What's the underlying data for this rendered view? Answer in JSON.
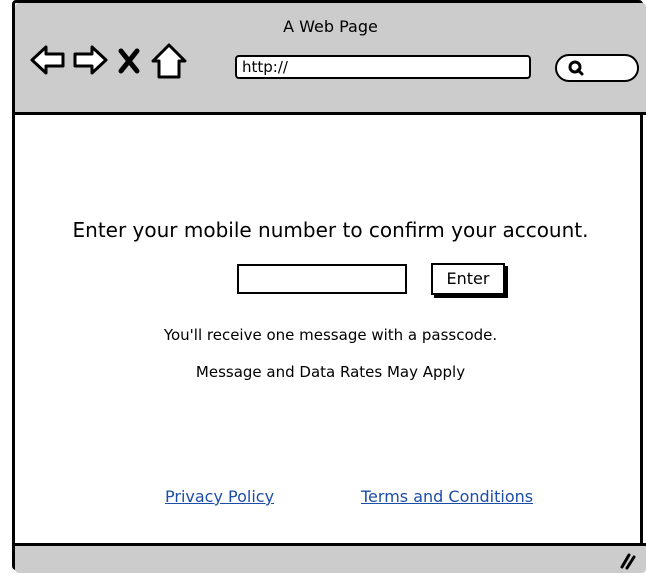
{
  "window": {
    "title": "A Web Page",
    "url": "http://"
  },
  "icons": {
    "back": "left-arrow-icon",
    "forward": "right-arrow-icon",
    "stop": "close-icon",
    "home": "home-icon",
    "search": "search-icon",
    "resize": "resize-grip-icon"
  },
  "main": {
    "prompt": "Enter your mobile number to confirm your account.",
    "phone_value": "",
    "enter_label": "Enter",
    "info_line1": "You'll receive one message with a passcode.",
    "info_line2": "Message and Data Rates May Apply"
  },
  "footer": {
    "privacy_label": "Privacy Policy",
    "terms_label": "Terms and Conditions"
  },
  "colors": {
    "chrome": "#cccccc",
    "link": "#1d4ea6"
  }
}
